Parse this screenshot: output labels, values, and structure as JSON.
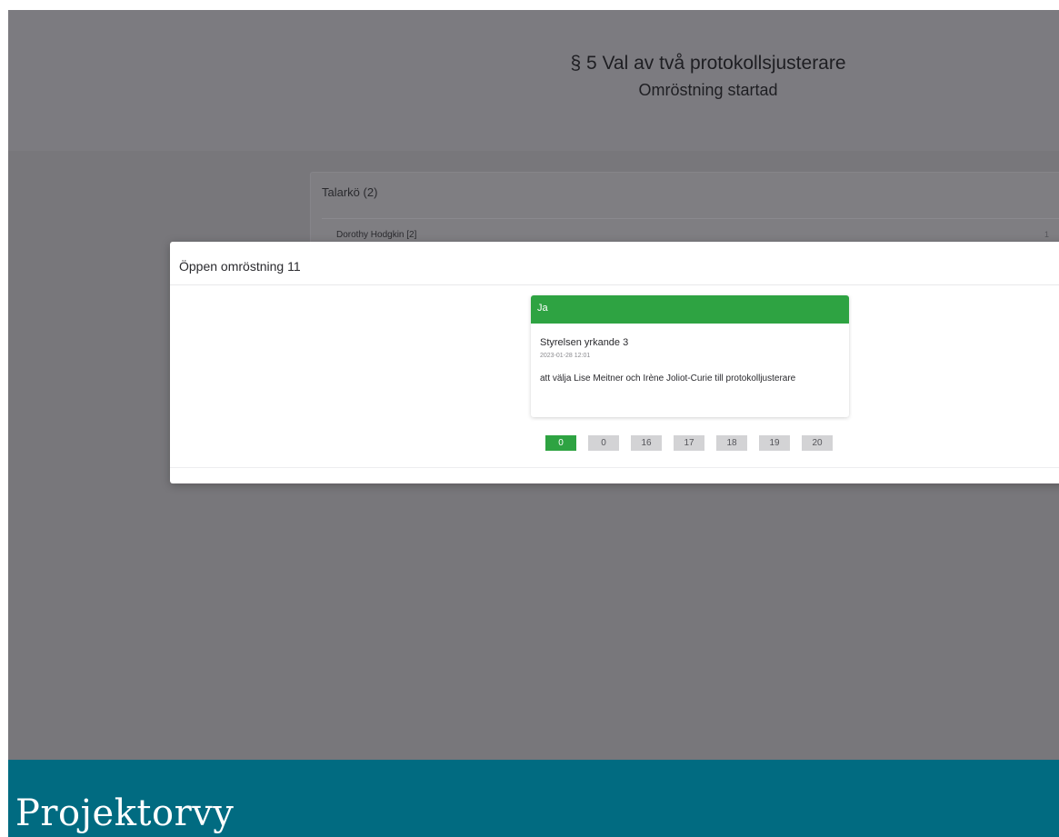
{
  "header": {
    "title": "§ 5 Val av två protokollsjusterare",
    "subtitle": "Omröstning startad"
  },
  "speakers": {
    "title": "Talarkö (2)",
    "items": [
      {
        "name": "Dorothy Hodgkin [2]",
        "count": "1"
      }
    ]
  },
  "modal": {
    "title": "Öppen omröstning 11",
    "option": {
      "label": "Ja",
      "proposal_title": "Styrelsen yrkande 3",
      "timestamp": "2023-01-28 12:01",
      "text": "att välja Lise Meitner och Irène Joliot-Curie till protokolljusterare"
    },
    "votes": [
      "0",
      "0",
      "16",
      "17",
      "18",
      "19",
      "20"
    ],
    "active_vote_index": 0
  },
  "footer": {
    "title": "Projektorvy"
  },
  "colors": {
    "accent_green": "#2ea342",
    "footer_teal": "#016b81",
    "backdrop": "#7b7a7e"
  }
}
